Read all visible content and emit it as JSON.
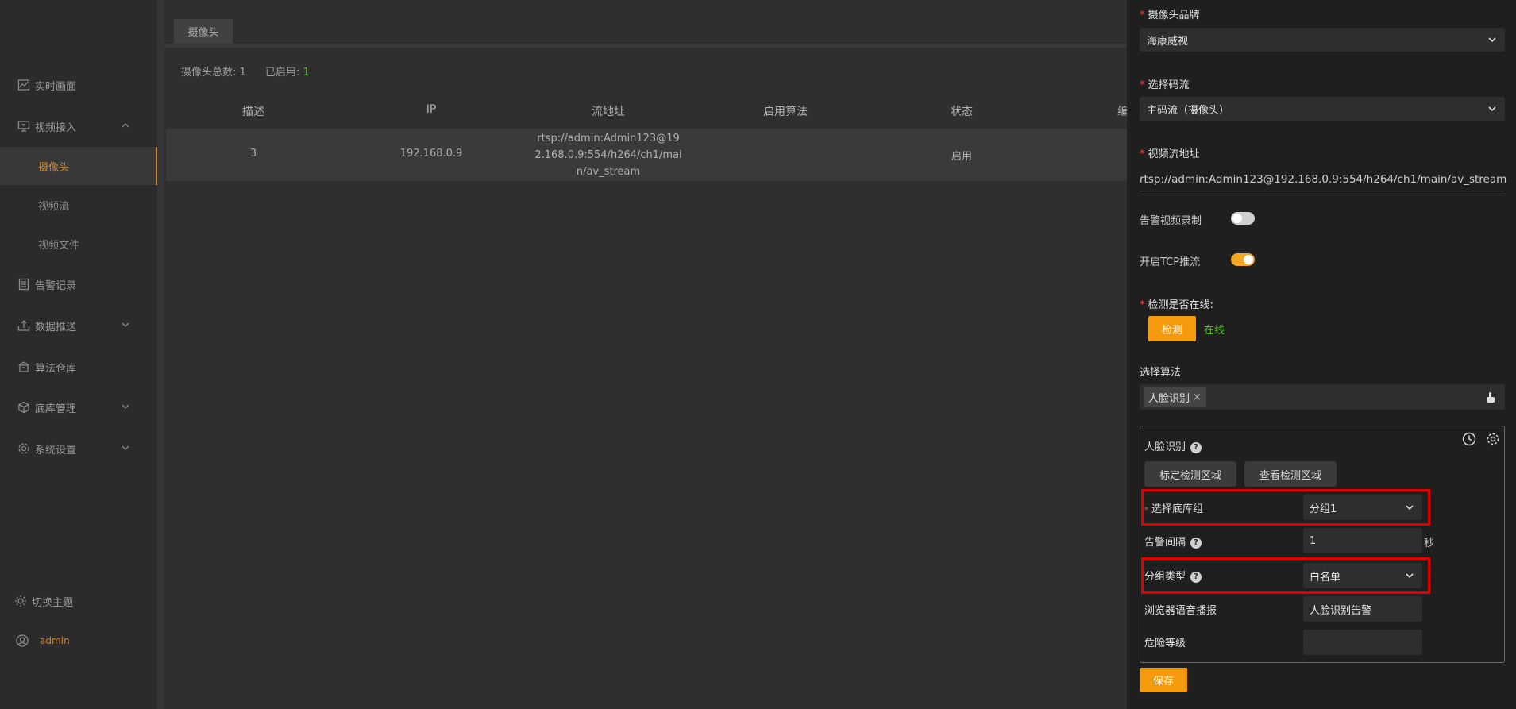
{
  "sidebar": {
    "items": [
      {
        "label": "实时画面",
        "icon": "chart-line-icon"
      },
      {
        "label": "视频接入",
        "icon": "monitor-icon",
        "expanded": true
      },
      {
        "label": "告警记录",
        "icon": "document-icon"
      },
      {
        "label": "数据推送",
        "icon": "upload-icon"
      },
      {
        "label": "算法仓库",
        "icon": "warehouse-icon"
      },
      {
        "label": "底库管理",
        "icon": "cube-icon"
      },
      {
        "label": "系统设置",
        "icon": "gear-icon"
      }
    ],
    "sub_items": [
      {
        "label": "摄像头",
        "active": true
      },
      {
        "label": "视频流"
      },
      {
        "label": "视频文件"
      }
    ],
    "theme_label": "切换主题",
    "user": "admin"
  },
  "main": {
    "tab": "摄像头",
    "stats": {
      "total_label": "摄像头总数:",
      "total": "1",
      "enabled_label": "已启用:",
      "enabled": "1"
    },
    "table": {
      "columns": [
        "描述",
        "IP",
        "流地址",
        "启用算法",
        "状态",
        "编"
      ],
      "rows": [
        {
          "desc": "3",
          "ip": "192.168.0.9",
          "stream": "rtsp://admin:Admin123@192.168.0.9:554/h264/ch1/main/av_stream",
          "algo": "",
          "status": "启用"
        }
      ]
    }
  },
  "drawer": {
    "brand_label": "摄像头品牌",
    "brand_value": "海康威视",
    "stream_label": "选择码流",
    "stream_value": "主码流（摄像头）",
    "url_label": "视频流地址",
    "url_value": "rtsp://admin:Admin123@192.168.0.9:554/h264/ch1/main/av_stream",
    "record_label": "告警视频录制",
    "record_on": false,
    "tcp_label": "开启TCP推流",
    "tcp_on": true,
    "online_label": "检测是否在线:",
    "detect_button": "检测",
    "online_status": "在线",
    "algo_label": "选择算法",
    "algo_tag": "人脸识别",
    "card": {
      "title": "人脸识别",
      "mark_area_button": "标定检测区域",
      "view_area_button": "查看检测区域",
      "group_label": "选择底库组",
      "group_value": "分组1",
      "interval_label": "告警间隔",
      "interval_value": "1",
      "interval_unit": "秒",
      "type_label": "分组类型",
      "type_value": "白名单",
      "voice_label": "浏览器语音播报",
      "voice_value": "人脸识别告警",
      "danger_label": "危险等级",
      "danger_value": ""
    },
    "save_button": "保存"
  },
  "colors": {
    "accent": "#f59a0c",
    "active_nav": "#c8873a",
    "online": "#52c41a",
    "highlight": "#e00000"
  }
}
